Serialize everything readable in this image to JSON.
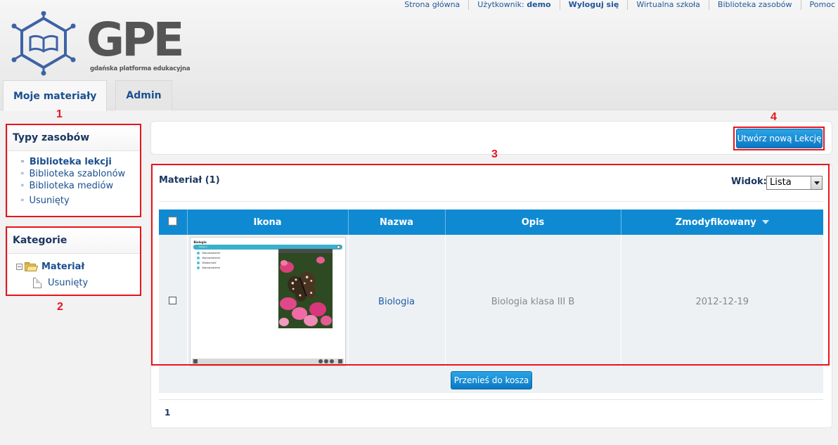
{
  "toplinks": {
    "home": "Strona główna",
    "user_label": "Użytkownik:",
    "user_name": "demo",
    "logout": "Wyloguj się",
    "virtual_school": "Wirtualna szkoła",
    "resource_library": "Biblioteka zasobów",
    "help": "Pomoc"
  },
  "logo": {
    "text": "GPE",
    "subtitle": "gdańska platforma edukacyjna"
  },
  "tabs": [
    {
      "label": "Moje materiały",
      "active": true
    },
    {
      "label": "Admin",
      "active": false
    }
  ],
  "resource_types": {
    "title": "Typy zasobów",
    "items": [
      "Biblioteka lekcji",
      "Biblioteka szablonów",
      "Biblioteka mediów",
      "Usunięty"
    ],
    "selected_index": 0
  },
  "categories": {
    "title": "Kategorie",
    "root": "Materiał",
    "child": "Usunięty"
  },
  "toolbar": {
    "new_lesson_button": "Utwórz nową Lekcję"
  },
  "materials": {
    "title": "Materiał (1)",
    "view_label": "Widok:",
    "view_value": "Lista",
    "columns": [
      "",
      "Ikona",
      "Nazwa",
      "Opis",
      "Zmodyfikowany"
    ],
    "rows": [
      {
        "name": "Biologia",
        "description": "Biologia klasa III B",
        "modified": "2012-12-19",
        "thumbnail": {
          "title": "Biologia",
          "lesson_label": "Lekcja 1",
          "bullets": [
            "Wprowadzenie",
            "Wprowadzenie",
            "Wiadomość",
            "Wprowadzenie"
          ]
        }
      }
    ],
    "trash_button": "Przenieś do kosza",
    "page": "1"
  },
  "annotations": [
    "1",
    "2",
    "3",
    "4"
  ],
  "colors": {
    "accent": "#0f8ad2",
    "annotation_red": "#e8141c",
    "link": "#1b4f8f"
  }
}
